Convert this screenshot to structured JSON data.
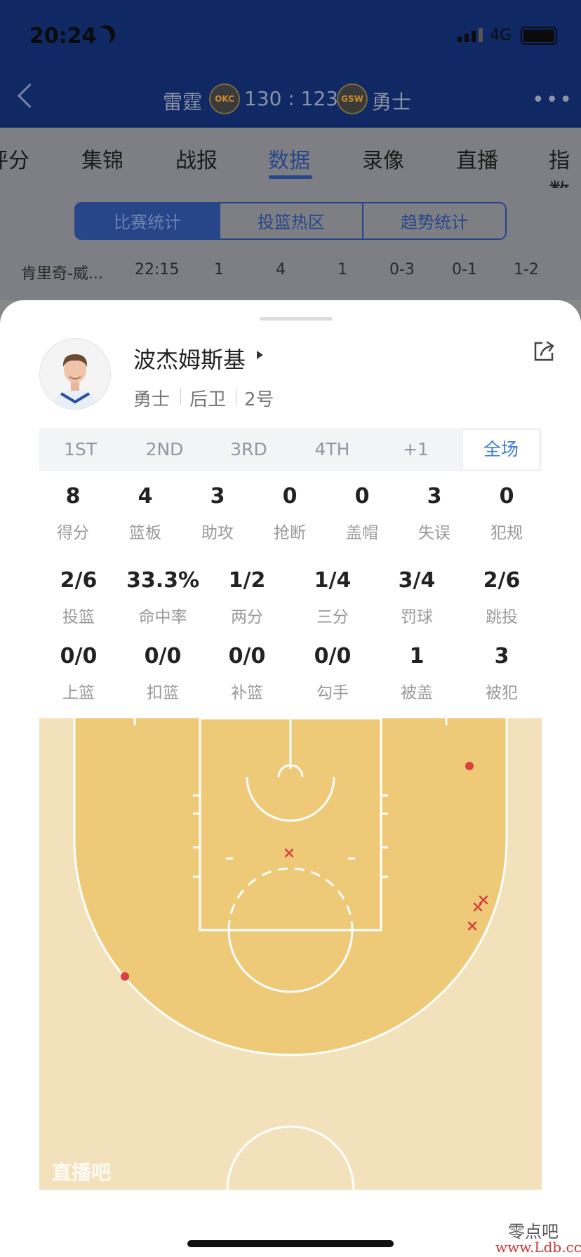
{
  "status_bar": {
    "time": "20:24",
    "network": "4G"
  },
  "header": {
    "home_team": "雷霆",
    "home_badge": "OKC",
    "score": "130 : 123",
    "away_badge": "GSW",
    "away_team": "勇士"
  },
  "tabs": [
    "评分",
    "集锦",
    "战报",
    "数据",
    "录像",
    "直播",
    "指数"
  ],
  "segments": [
    "比赛统计",
    "投篮热区",
    "趋势统计"
  ],
  "bg_row": [
    "肯里奇-威...",
    "22:15",
    "1",
    "4",
    "1",
    "0-3",
    "0-1",
    "1-2"
  ],
  "player": {
    "name": "波杰姆斯基",
    "team": "勇士",
    "position": "后卫",
    "number": "2号"
  },
  "quarters": [
    "1ST",
    "2ND",
    "3RD",
    "4TH",
    "+1",
    "全场"
  ],
  "stats_row1": [
    {
      "v": "8",
      "l": "得分"
    },
    {
      "v": "4",
      "l": "篮板"
    },
    {
      "v": "3",
      "l": "助攻"
    },
    {
      "v": "0",
      "l": "抢断"
    },
    {
      "v": "0",
      "l": "盖帽"
    },
    {
      "v": "3",
      "l": "失误"
    },
    {
      "v": "0",
      "l": "犯规"
    }
  ],
  "stats_row2": [
    {
      "v": "2/6",
      "l": "投篮"
    },
    {
      "v": "33.3%",
      "l": "命中率"
    },
    {
      "v": "1/2",
      "l": "两分"
    },
    {
      "v": "1/4",
      "l": "三分"
    },
    {
      "v": "3/4",
      "l": "罚球"
    },
    {
      "v": "2/6",
      "l": "跳投"
    }
  ],
  "stats_row3": [
    {
      "v": "0/0",
      "l": "上篮"
    },
    {
      "v": "0/0",
      "l": "扣篮"
    },
    {
      "v": "0/0",
      "l": "补篮"
    },
    {
      "v": "0/0",
      "l": "勾手"
    },
    {
      "v": "1",
      "l": "被盖"
    },
    {
      "v": "3",
      "l": "被犯"
    }
  ],
  "shot_chart": {
    "made_shots": 2,
    "missed_shots": 4,
    "colors": {
      "made": "#d9403f",
      "missed": "#d9403f",
      "paint": "#eec978",
      "floor": "#f3e1bc"
    }
  },
  "watermark": "直播吧",
  "site_mark": {
    "line1": "零点吧",
    "line2": "www.Ldb.cc"
  }
}
